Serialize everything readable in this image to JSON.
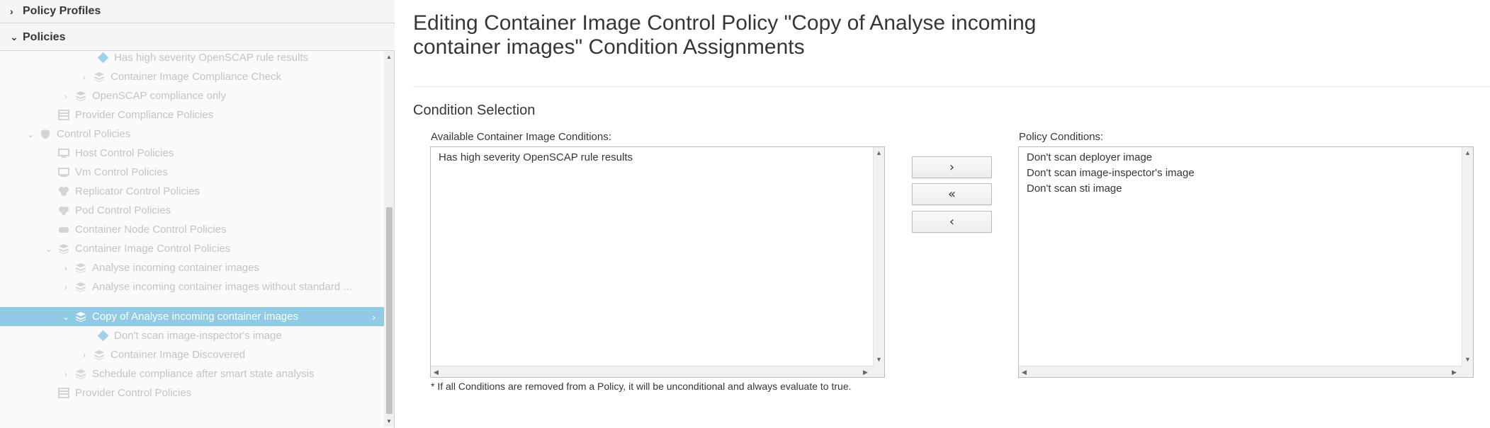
{
  "sidebar": {
    "accordions": [
      {
        "label": "Policy Profiles",
        "expanded": false
      },
      {
        "label": "Policies",
        "expanded": true
      }
    ],
    "tree": [
      {
        "label": "Has high severity OpenSCAP rule results",
        "icon": "condition-diamond-icon"
      },
      {
        "label": "Container Image Compliance Check",
        "icon": "stack-icon"
      },
      {
        "label": "OpenSCAP compliance only",
        "icon": "stack-icon"
      },
      {
        "label": "Provider Compliance Policies",
        "icon": "folder-icon"
      },
      {
        "label": "Control Policies",
        "icon": "shield-icon"
      },
      {
        "label": "Host Control Policies",
        "icon": "host-icon"
      },
      {
        "label": "Vm Control Policies",
        "icon": "vm-icon"
      },
      {
        "label": "Replicator Control Policies",
        "icon": "replicator-icon"
      },
      {
        "label": "Pod Control Policies",
        "icon": "pod-icon"
      },
      {
        "label": "Container Node Control Policies",
        "icon": "node-icon"
      },
      {
        "label": "Container Image Control Policies",
        "icon": "stack-icon"
      },
      {
        "label": "Analyse incoming container images",
        "icon": "stack-icon"
      },
      {
        "label": "Analyse incoming container images without standard ...",
        "icon": "stack-icon"
      },
      {
        "label": "Copy of Analyse incoming container images",
        "icon": "stack-icon",
        "selected": true
      },
      {
        "label": "Don't scan image-inspector's image",
        "icon": "condition-diamond-icon"
      },
      {
        "label": "Container Image Discovered",
        "icon": "stack-icon"
      },
      {
        "label": "Schedule compliance after smart state analysis",
        "icon": "stack-icon"
      },
      {
        "label": "Provider Control Policies",
        "icon": "folder-icon"
      }
    ]
  },
  "main": {
    "title": "Editing Container Image Control Policy \"Copy of Analyse incoming container images\" Condition Assignments",
    "section_title": "Condition Selection",
    "available_label": "Available Container Image Conditions:",
    "available_items": [
      "Has high severity OpenSCAP rule results"
    ],
    "policy_label": "Policy Conditions:",
    "policy_items": [
      "Don't scan deployer image",
      "Don't scan image-inspector's image",
      "Don't scan sti image"
    ],
    "buttons": {
      "add": "›",
      "remove_all": "«",
      "remove": "‹"
    },
    "footnote": "* If all Conditions are removed from a Policy, it will be unconditional and always evaluate to true."
  },
  "colors": {
    "selected_row": "#8fcbe4",
    "muted_text": "#c4c4c4",
    "diamond": "#9ed1ea"
  }
}
